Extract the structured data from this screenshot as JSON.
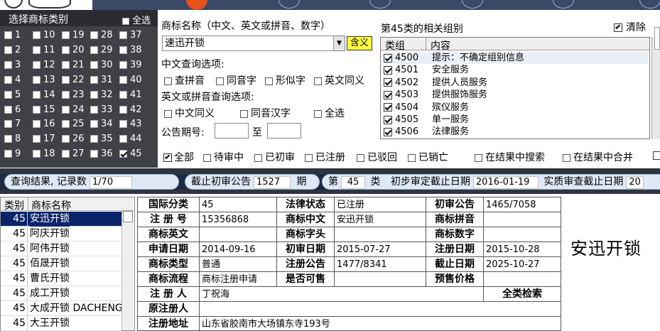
{
  "category_panel": {
    "title": "选择商标类别",
    "select_all": "全选",
    "classes": [
      [
        "1",
        "10",
        "19",
        "28",
        "37"
      ],
      [
        "2",
        "11",
        "20",
        "29",
        "38"
      ],
      [
        "3",
        "12",
        "21",
        "30",
        "39"
      ],
      [
        "4",
        "13",
        "22",
        "31",
        "40"
      ],
      [
        "5",
        "14",
        "23",
        "32",
        "41"
      ],
      [
        "6",
        "15",
        "24",
        "33",
        "42"
      ],
      [
        "7",
        "16",
        "25",
        "34",
        "43"
      ],
      [
        "8",
        "17",
        "26",
        "35",
        "44"
      ],
      [
        "9",
        "18",
        "27",
        "36",
        "45"
      ]
    ],
    "checked_class": "45"
  },
  "search": {
    "name_label": "商标名称（中文、英文或拼音、数字）",
    "name_value": "速迅开锁",
    "meaning_button": "含义",
    "cn_options_label": "中文查询选项:",
    "cn_options": [
      "查拼音",
      "同音字",
      "形似字",
      "英文同义"
    ],
    "en_options_label": "英文或拼音查询选项:",
    "en_options": [
      "中文同义",
      "同音汉字",
      "全选"
    ],
    "period_label": "公告期号:",
    "period_to": "至"
  },
  "groups": {
    "title": "第45类的相关组别",
    "clear_label": "清除",
    "col_group": "类组",
    "col_content": "内容",
    "rows": [
      {
        "code": "4500",
        "text": "提示：不确定组别信息"
      },
      {
        "code": "4501",
        "text": "安全服务"
      },
      {
        "code": "4502",
        "text": "提供人员服务"
      },
      {
        "code": "4503",
        "text": "提供服饰服务"
      },
      {
        "code": "4504",
        "text": "殡仪服务"
      },
      {
        "code": "4505",
        "text": "单一服务"
      },
      {
        "code": "4506",
        "text": "法律服务"
      }
    ]
  },
  "filters": {
    "all": "全部",
    "items": [
      "待审中",
      "已初审",
      "已注册",
      "已驳回",
      "已销亡"
    ],
    "search_in_results": "在结果中搜索",
    "merge_in_results": "在结果中合并"
  },
  "status": {
    "result_label": "查询结果, 记录数",
    "result_value": "1/70",
    "cutoff_label": "截止初审公告",
    "cutoff_value": "1527",
    "cutoff_suffix": "期",
    "class_prefix": "第",
    "class_value": "45",
    "class_suffix": "类",
    "review_label": "初步审定截止日期",
    "review_value": "2016-01-19",
    "substantive_label": "实质审查截止日期",
    "substantive_value": "20"
  },
  "list": {
    "col_class": "类别",
    "col_name": "商标名称",
    "rows": [
      {
        "cls": "45",
        "name": "安迅开锁"
      },
      {
        "cls": "45",
        "name": "阿庆开锁"
      },
      {
        "cls": "45",
        "name": "阿伟开锁"
      },
      {
        "cls": "45",
        "name": "佰晟开锁"
      },
      {
        "cls": "45",
        "name": "曹氏开锁"
      },
      {
        "cls": "45",
        "name": "成工开锁"
      },
      {
        "cls": "45",
        "name": "大成开锁 DACHENG"
      },
      {
        "cls": "45",
        "name": "大王开锁"
      }
    ]
  },
  "detail": {
    "intl_class_label": "国际分类",
    "intl_class": "45",
    "legal_status_label": "法律状态",
    "legal_status": "已注册",
    "first_notice_label": "初审公告",
    "first_notice": "1465/7058",
    "reg_no_label": "注 册 号",
    "reg_no": "15356868",
    "cn_name_label": "商标中文",
    "cn_name": "安迅开锁",
    "pinyin_label": "商标拼音",
    "pinyin": "",
    "en_name_label": "商标英文",
    "en_name": "",
    "initials_label": "商标字头",
    "initials": "",
    "digits_label": "商标数字",
    "digits": "",
    "apply_date_label": "申请日期",
    "apply_date": "2014-09-16",
    "first_date_label": "初审日期",
    "first_date": "2015-07-27",
    "reg_date_label": "注册日期",
    "reg_date": "2015-10-28",
    "type_label": "商标类型",
    "type": "普通",
    "reg_notice_label": "注册公告",
    "reg_notice": "1477/8341",
    "expire_label": "截止日期",
    "expire": "2025-10-27",
    "flow_label": "商标流程",
    "flow": "商标注册申请",
    "sellable_label": "是否可售",
    "sellable": "",
    "presale_label": "预售价格",
    "presale": "",
    "registrant_label": "注 册 人",
    "registrant": "丁祝海",
    "full_search_label": "全类检索",
    "orig_registrant_label": "原注册人",
    "orig_registrant": "",
    "address_label": "注册地址",
    "address": "山东省胶南市大场镇东寺193号",
    "big_name": "安迅开锁"
  }
}
